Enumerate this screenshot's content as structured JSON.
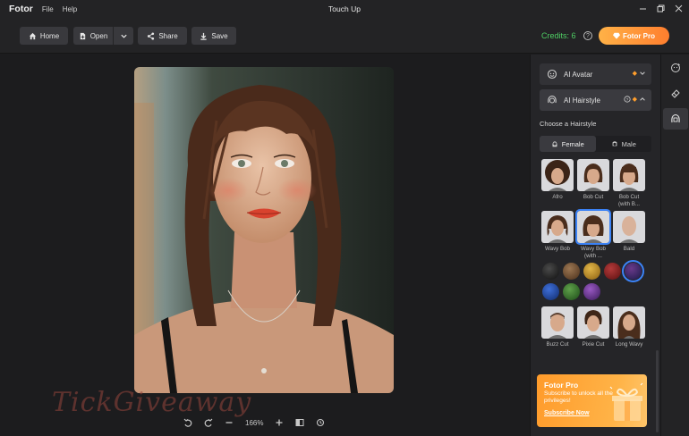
{
  "app": {
    "logo": "Fotor",
    "title": "Touch Up"
  },
  "menu": [
    "File",
    "Help"
  ],
  "toolbar": {
    "home": "Home",
    "open": "Open",
    "share": "Share",
    "save": "Save",
    "credits": "Credits: 6",
    "help": "?",
    "pro": "Fotor Pro"
  },
  "canvas": {
    "watermark": "TickGiveaway",
    "zoom": "166%"
  },
  "panel": {
    "ai_avatar": "AI Avatar",
    "ai_hairstyle": "AI Hairstyle",
    "choose": "Choose a Hairstyle",
    "tabs": [
      "Female",
      "Male"
    ],
    "hairstyles_row1": [
      {
        "label": "Afro",
        "hair": "#3b2417"
      },
      {
        "label": "Bob Cut",
        "hair": "#4a2d1c"
      },
      {
        "label": "Bob Cut (with B...",
        "hair": "#4a2d1c"
      }
    ],
    "hairstyles_row2": [
      {
        "label": "Wavy Bob",
        "hair": "#4a2d1c"
      },
      {
        "label": "Wavy Bob (with ...",
        "hair": "#4a2d1c"
      },
      {
        "label": "Bald",
        "hair": "#d6b49c"
      }
    ],
    "hairstyles_row3": [
      {
        "label": "Buzz Cut",
        "hair": "#5a4030"
      },
      {
        "label": "Pixie Cut",
        "hair": "#3e2618"
      },
      {
        "label": "Long Wavy",
        "hair": "#4a2d1c"
      }
    ],
    "colors": [
      "#1c1c1c",
      "#6b4a2e",
      "#b8861b",
      "#7a1717",
      "#1f2a6b",
      "#1b3b8a",
      "#2f6b2a",
      "#5b2d7a"
    ],
    "promo": {
      "title": "Fotor Pro",
      "text": "Subscribe to unlock all the privileges!",
      "link": "Subscribe Now"
    }
  },
  "colors": {
    "accent": "#ff9b2b",
    "credits": "#4fcf64",
    "selection": "#3b82f6"
  }
}
